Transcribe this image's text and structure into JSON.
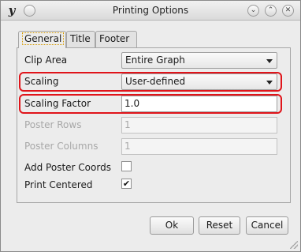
{
  "window": {
    "title": "Printing Options",
    "app_icon": "y-italic-logo-icon",
    "title_buttons": [
      "minimize-icon",
      "maximize-icon",
      "close-icon"
    ]
  },
  "tabs": [
    {
      "label": "General",
      "active": true
    },
    {
      "label": "Title",
      "active": false
    },
    {
      "label": "Footer",
      "active": false
    }
  ],
  "general": {
    "clip_area": {
      "label": "Clip Area",
      "value": "Entire Graph"
    },
    "scaling": {
      "label": "Scaling",
      "value": "User-defined"
    },
    "scaling_factor": {
      "label": "Scaling Factor",
      "value": "1.0"
    },
    "poster_rows": {
      "label": "Poster Rows",
      "value": "1",
      "enabled": false
    },
    "poster_columns": {
      "label": "Poster Columns",
      "value": "1",
      "enabled": false
    },
    "add_poster_coords": {
      "label": "Add Poster Coords",
      "checked": false,
      "mark": ""
    },
    "print_centered": {
      "label": "Print Centered",
      "checked": true,
      "mark": "✔"
    }
  },
  "buttons": {
    "ok": "Ok",
    "reset": "Reset",
    "cancel": "Cancel"
  },
  "colors": {
    "highlight": "#e0141a",
    "focus_dots": "#d59a00"
  }
}
